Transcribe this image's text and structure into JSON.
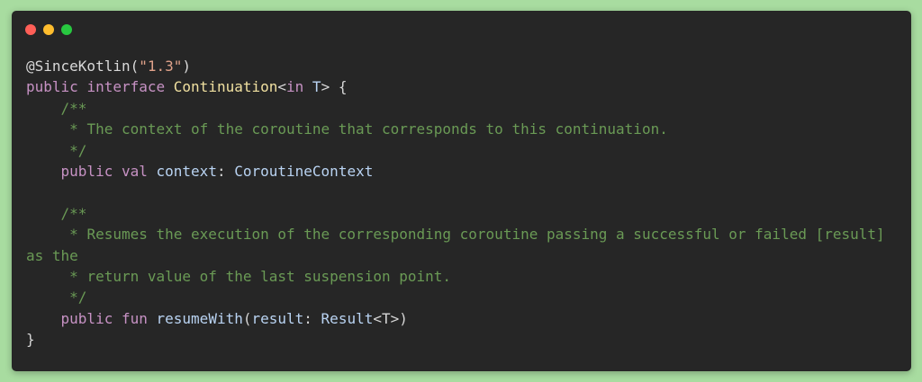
{
  "window": {
    "controls": [
      {
        "name": "close",
        "color": "#ff5f57"
      },
      {
        "name": "minimize",
        "color": "#ffbd2e"
      },
      {
        "name": "maximize",
        "color": "#28c840"
      }
    ]
  },
  "code": {
    "line1": {
      "annotation": "@SinceKotlin(",
      "version": "\"1.3\"",
      "close": ")"
    },
    "line2": {
      "public": "public",
      "interface": "interface",
      "name": "Continuation",
      "open_generic": "<",
      "in_kw": "in",
      "space": " ",
      "type_param": "T",
      "close_generic": ">",
      "brace": " {"
    },
    "line3": "    /**",
    "line4": "     * The context of the coroutine that corresponds to this continuation.",
    "line5": "     */",
    "line6": {
      "indent": "    ",
      "public": "public",
      "val": "val",
      "prop": "context",
      "colon": ": ",
      "type": "CoroutineContext"
    },
    "line7": "",
    "line8": "    /**",
    "line9": "     * Resumes the execution of the corresponding coroutine passing a successful or failed [result] as the",
    "line10": "     * return value of the last suspension point.",
    "line11": "     */",
    "line12": {
      "indent": "    ",
      "public": "public",
      "fun": "fun",
      "name": "resumeWith",
      "open": "(",
      "param": "result",
      "colon": ": ",
      "type": "Result",
      "generic": "<T>",
      "close": ")"
    },
    "line13": "}"
  }
}
